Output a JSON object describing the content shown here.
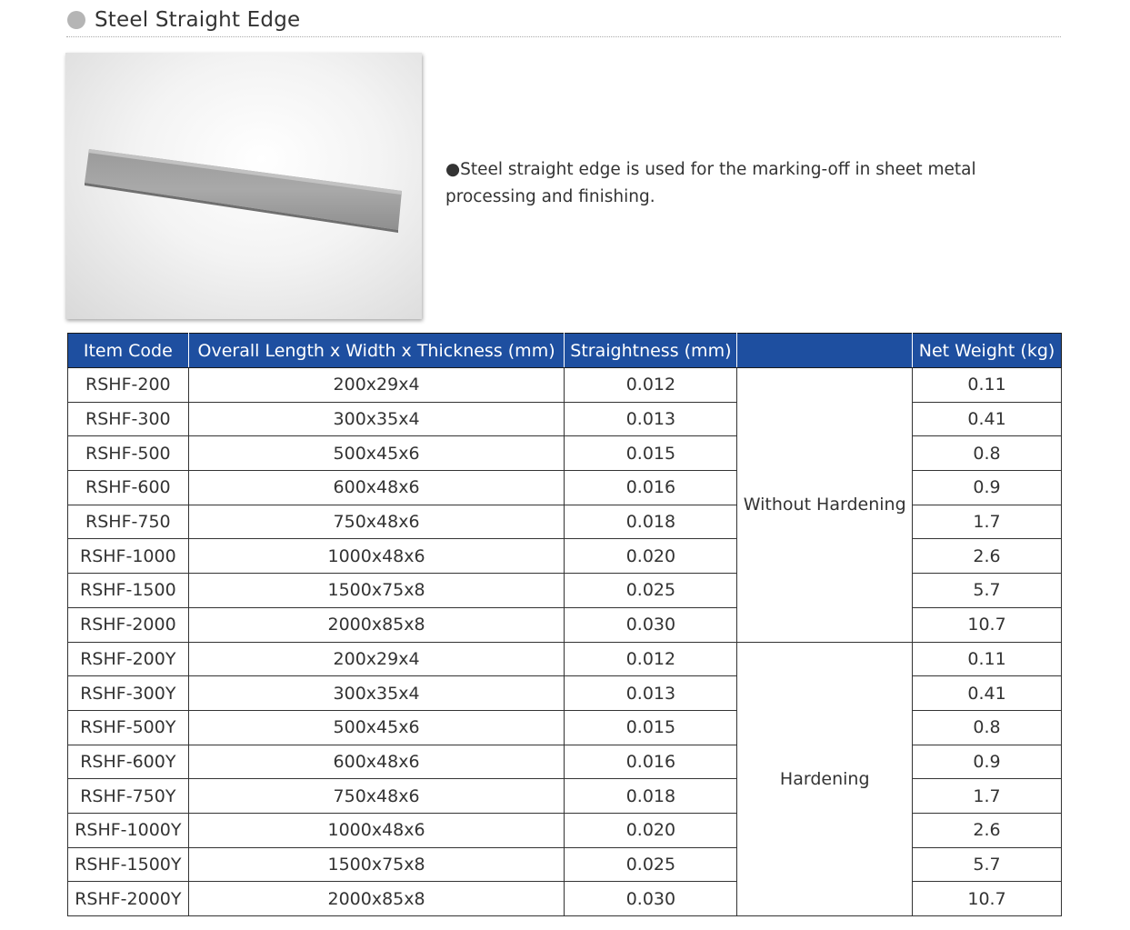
{
  "section": {
    "title": "Steel Straight Edge",
    "bullet_icon": "grey-circle"
  },
  "photo": {
    "subject": "steel straight edge bar"
  },
  "description": "●Steel straight edge is used for the marking-off in sheet metal processing and finishing.",
  "colors": {
    "header_bg": "#1e4fa0",
    "header_text": "#ffffff",
    "bullet": "#b5b5b5"
  },
  "table": {
    "headers": [
      "Item Code",
      "Overall Length x Width x Thickness (mm)",
      "Straightness (mm)",
      "",
      "Net Weight (kg)"
    ],
    "groups": [
      {
        "label": "Without Hardening",
        "rows": [
          {
            "code": "RSHF-200",
            "size": "200x29x4",
            "straightness": "0.012",
            "weight": "0.11"
          },
          {
            "code": "RSHF-300",
            "size": "300x35x4",
            "straightness": "0.013",
            "weight": "0.41"
          },
          {
            "code": "RSHF-500",
            "size": "500x45x6",
            "straightness": "0.015",
            "weight": "0.8"
          },
          {
            "code": "RSHF-600",
            "size": "600x48x6",
            "straightness": "0.016",
            "weight": "0.9"
          },
          {
            "code": "RSHF-750",
            "size": "750x48x6",
            "straightness": "0.018",
            "weight": "1.7"
          },
          {
            "code": "RSHF-1000",
            "size": "1000x48x6",
            "straightness": "0.020",
            "weight": "2.6"
          },
          {
            "code": "RSHF-1500",
            "size": "1500x75x8",
            "straightness": "0.025",
            "weight": "5.7"
          },
          {
            "code": "RSHF-2000",
            "size": "2000x85x8",
            "straightness": "0.030",
            "weight": "10.7"
          }
        ]
      },
      {
        "label": "Hardening",
        "rows": [
          {
            "code": "RSHF-200Y",
            "size": "200x29x4",
            "straightness": "0.012",
            "weight": "0.11"
          },
          {
            "code": "RSHF-300Y",
            "size": "300x35x4",
            "straightness": "0.013",
            "weight": "0.41"
          },
          {
            "code": "RSHF-500Y",
            "size": "500x45x6",
            "straightness": "0.015",
            "weight": "0.8"
          },
          {
            "code": "RSHF-600Y",
            "size": "600x48x6",
            "straightness": "0.016",
            "weight": "0.9"
          },
          {
            "code": "RSHF-750Y",
            "size": "750x48x6",
            "straightness": "0.018",
            "weight": "1.7"
          },
          {
            "code": "RSHF-1000Y",
            "size": "1000x48x6",
            "straightness": "0.020",
            "weight": "2.6"
          },
          {
            "code": "RSHF-1500Y",
            "size": "1500x75x8",
            "straightness": "0.025",
            "weight": "5.7"
          },
          {
            "code": "RSHF-2000Y",
            "size": "2000x85x8",
            "straightness": "0.030",
            "weight": "10.7"
          }
        ]
      }
    ]
  }
}
